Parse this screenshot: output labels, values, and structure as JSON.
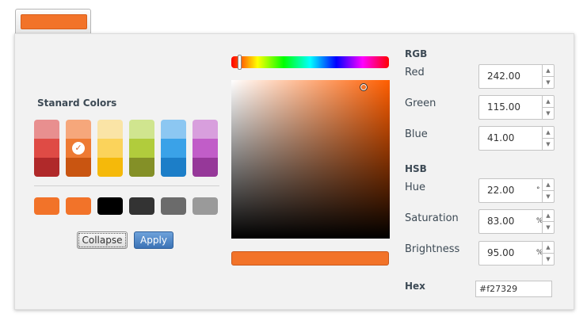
{
  "trigger": {
    "color": "#f27329"
  },
  "standard": {
    "title": "Stanard Colors",
    "columns": [
      {
        "shades": [
          "#e88f8f",
          "#df4b45",
          "#b0292a"
        ]
      },
      {
        "shades": [
          "#f6a77b",
          "#ee7a33",
          "#c95511"
        ],
        "selected": true
      },
      {
        "shades": [
          "#fae4a6",
          "#fbd35b",
          "#f5b90a"
        ]
      },
      {
        "shades": [
          "#d0e58f",
          "#b1cc3c",
          "#849027"
        ]
      },
      {
        "shades": [
          "#8cc7f2",
          "#3aa2e8",
          "#1c7ec8"
        ]
      },
      {
        "shades": [
          "#d89fdd",
          "#c15dc8",
          "#963899"
        ]
      }
    ],
    "selected_icon": "checkmark-icon"
  },
  "recent": [
    "#f27329",
    "#f27329",
    "#000000",
    "#333333",
    "#6b6b6b",
    "#9a9a9a"
  ],
  "buttons": {
    "collapse": "Collapse",
    "apply": "Apply"
  },
  "picker": {
    "hue_deg": 22,
    "preview_color": "#f27329"
  },
  "rgb": {
    "title": "RGB",
    "red_label": "Red",
    "red": "242.00",
    "green_label": "Green",
    "green": "115.00",
    "blue_label": "Blue",
    "blue": "41.00"
  },
  "hsb": {
    "title": "HSB",
    "hue_label": "Hue",
    "hue": "22.00",
    "hue_unit": "°",
    "sat_label": "Saturation",
    "sat": "83.00",
    "sat_unit": "%",
    "bri_label": "Brightness",
    "bri": "95.00",
    "bri_unit": "%"
  },
  "hex": {
    "label": "Hex",
    "value": "#f27329"
  }
}
